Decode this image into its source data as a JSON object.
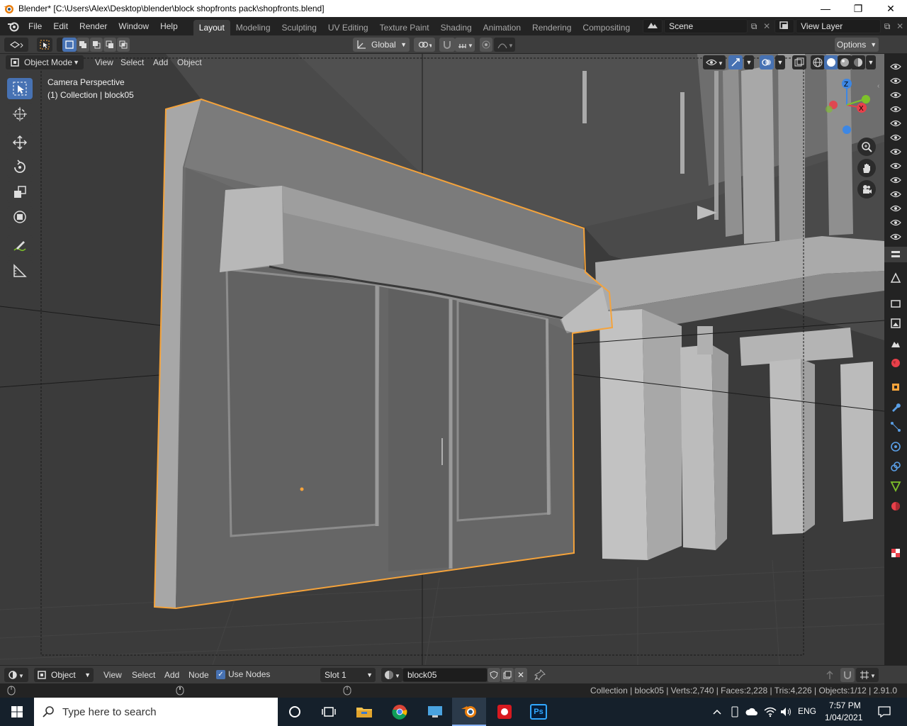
{
  "window": {
    "title": "Blender* [C:\\Users\\Alex\\Desktop\\blender\\block shopfronts pack\\shopfronts.blend]",
    "minimize": "—",
    "maximize": "❐",
    "close": "✕"
  },
  "menu": [
    "File",
    "Edit",
    "Render",
    "Window",
    "Help"
  ],
  "workspaces": {
    "tabs": [
      "Layout",
      "Modeling",
      "Sculpting",
      "UV Editing",
      "Texture Paint",
      "Shading",
      "Animation",
      "Rendering",
      "Compositing"
    ],
    "active": "Layout"
  },
  "scene": {
    "name": "Scene"
  },
  "view_layer": {
    "name": "View Layer"
  },
  "tool_header": {
    "transform_orientation": "Global",
    "options": "Options"
  },
  "viewport_header": {
    "mode": "Object Mode",
    "items": [
      "View",
      "Select",
      "Add",
      "Object"
    ]
  },
  "viewport_overlay": {
    "perspective": "Camera Perspective",
    "collection": "(1) Collection | block05"
  },
  "gizmo": {
    "x": "X",
    "y": "Y",
    "z": "Z"
  },
  "bottom_header": {
    "editor": "Object",
    "items": [
      "View",
      "Select",
      "Add",
      "Node"
    ],
    "use_nodes": "Use Nodes",
    "use_nodes_checked": true,
    "slot": "Slot 1",
    "material": "block05"
  },
  "status": {
    "stats": "Collection | block05 | Verts:2,740 | Faces:2,228 | Tris:4,226 | Objects:1/12 | 2.91.0"
  },
  "taskbar": {
    "search_placeholder": "Type here to search",
    "language": "ENG",
    "time": "7:57 PM",
    "date": "1/04/2021",
    "ps_label": "Ps"
  },
  "colors": {
    "selection_outline": "#f5a33b",
    "accent": "#4772b3",
    "axis_x": "#e8404a",
    "axis_y": "#7ec22a",
    "axis_z": "#3d87e4"
  }
}
